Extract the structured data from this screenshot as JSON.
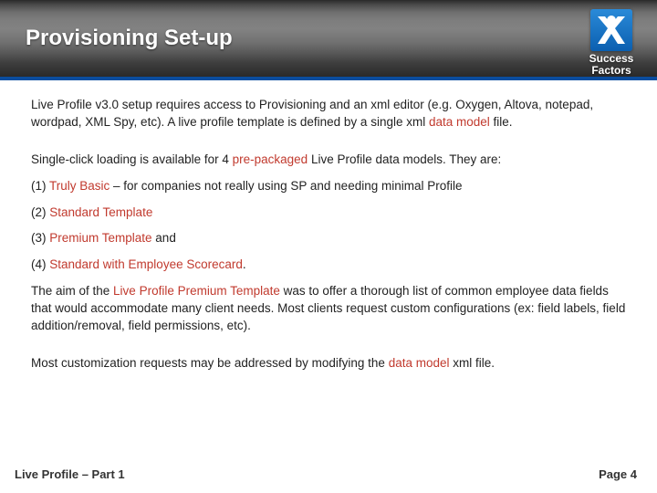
{
  "header": {
    "title": "Provisioning Set-up",
    "brand_line1": "Success",
    "brand_line2": "Factors"
  },
  "body": {
    "p1a": "Live Profile v3.0 setup requires access to Provisioning and an xml editor (e.g. Oxygen, Altova, notepad, wordpad, XML Spy, etc).  A live profile template is defined by a single xml ",
    "p1_hl": "data model",
    "p1b": " file.",
    "p2a": "Single-click loading is available for 4 ",
    "p2_hl": "pre-packaged",
    "p2b": " Live Profile data models.  They are:",
    "li1_a": "(1) ",
    "li1_hl": "Truly Basic",
    "li1_b": " – for companies not really using SP and needing minimal Profile",
    "li2_a": "(2) ",
    "li2_hl": "Standard Template",
    "li3_a": "(3) ",
    "li3_hl": "Premium Template",
    "li3_b": " and",
    "li4_a": "(4) ",
    "li4_hl": "Standard with Employee Scorecard",
    "li4_b": ".",
    "p3a": "The aim of the ",
    "p3_hl": "Live Profile Premium Template",
    "p3b": " was to offer a thorough list of common employee data fields that would accommodate many client needs.  Most clients request  custom configurations (ex: field labels, field addition/removal, field permissions, etc).",
    "p4a": "Most customization requests may be addressed by modifying the ",
    "p4_hl": "data model",
    "p4b": " xml file."
  },
  "footer": {
    "left": "Live Profile – Part 1",
    "right": "Page 4"
  }
}
